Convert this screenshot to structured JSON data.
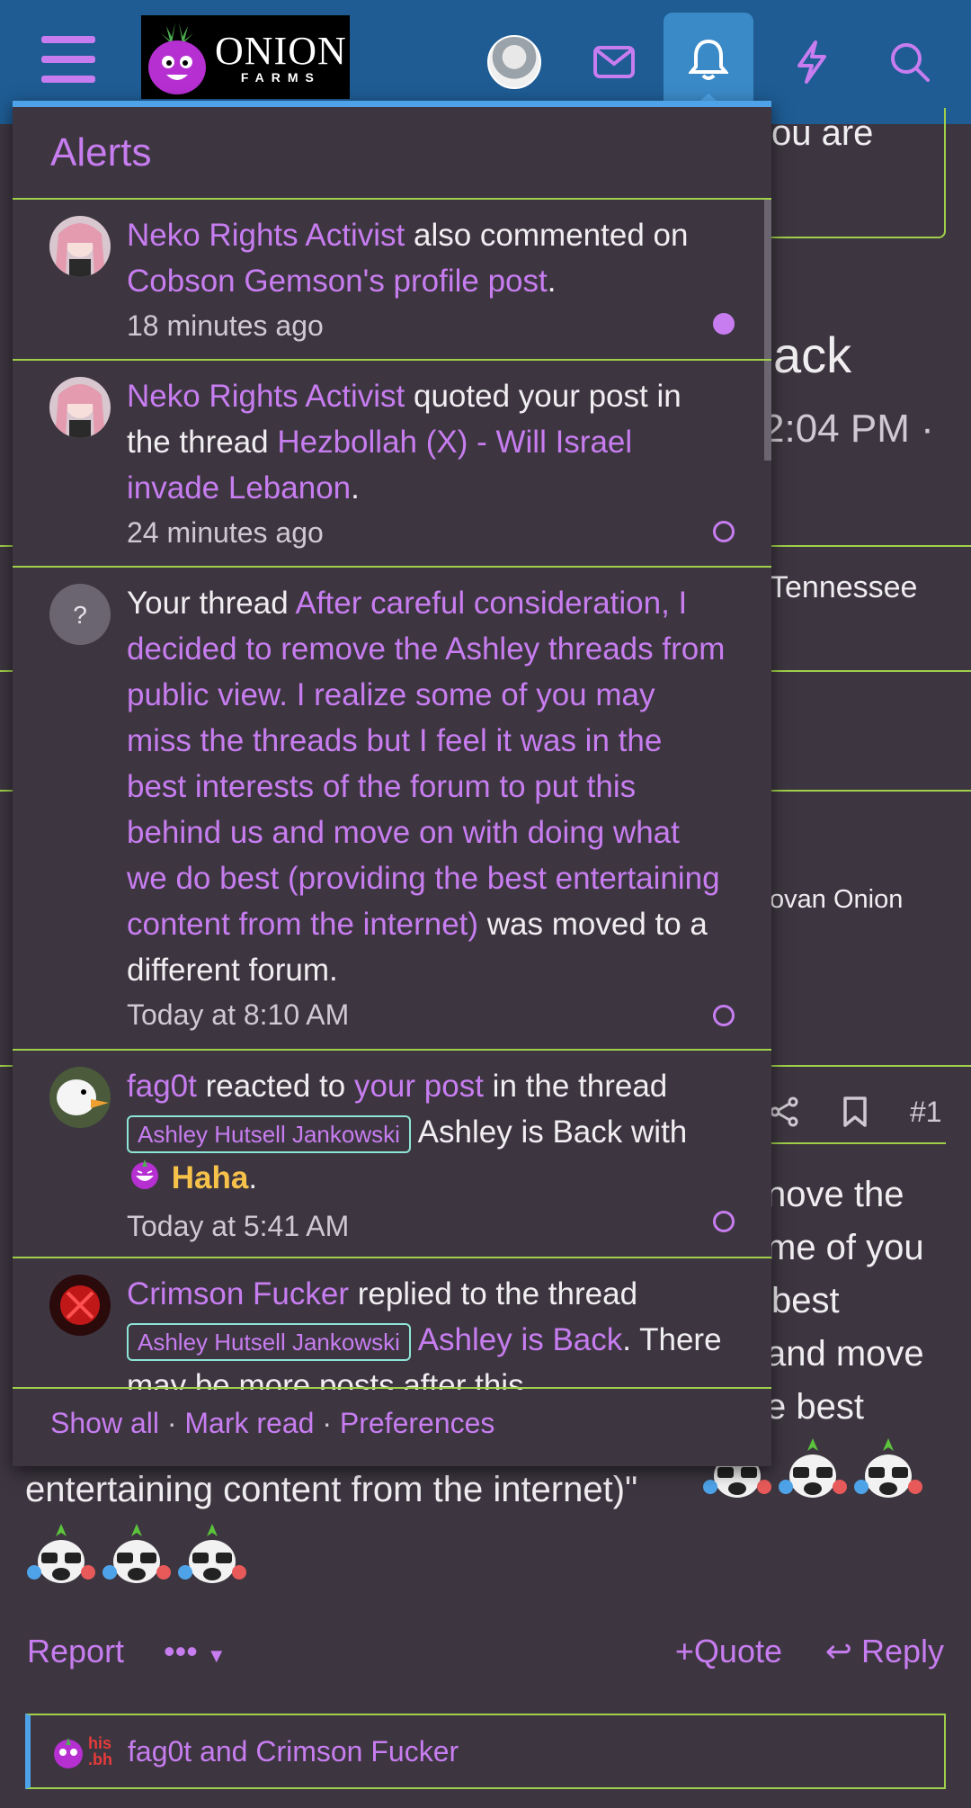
{
  "header": {
    "logo_big": "ONION",
    "logo_small": "FARMS"
  },
  "alerts": {
    "title": "Alerts",
    "items": [
      {
        "user": "Neko Rights Activist",
        "action": " also commented on ",
        "target": "Cobson Gemson's profile post",
        "tail": ".",
        "time": "18 minutes ago",
        "unread": true
      },
      {
        "user": "Neko Rights Activist",
        "action": " quoted your post in the thread ",
        "target": "Hezbollah (X) - Will Israel invade Lebanon",
        "tail": ".",
        "time": "24 minutes ago",
        "unread": false
      },
      {
        "avatar_letter": "?",
        "prefix": "Your thread ",
        "target": "After careful consideration, I decided to remove the Ashley threads from public view. I realize some of you may miss the threads but I feel it was in the best interests of the forum to put this behind us and move on with doing what we do best (providing the best entertaining content from the internet)",
        "tail": " was moved to a different forum.",
        "time": "Today at 8:10 AM",
        "unread": false
      },
      {
        "user": "fag0t",
        "action": " reacted to ",
        "target": "your post",
        "mid": " in the thread ",
        "prefix_tag": "Ashley Hutsell Jankowski",
        "thread": " Ashley is Back",
        "with": "with ",
        "reaction": "Haha",
        "tail": ".",
        "time": "Today at 5:41 AM",
        "unread": false
      },
      {
        "user": "Crimson Fucker",
        "action": " replied to the thread ",
        "prefix_tag": "Ashley Hutsell Jankowski",
        "thread": "Ashley is Back",
        "tail": ".",
        "extra": "There may be more posts after this."
      }
    ],
    "footer": {
      "show_all": "Show all",
      "sep": " · ",
      "mark_read": "Mark read",
      "preferences": "Preferences"
    }
  },
  "background": {
    "title_fragment": "ack",
    "time_fragment": "2:04 PM ·",
    "location_fragment": "Tennessee",
    "user_fragment": "ovan Onion",
    "post_number": "#1",
    "post_lines": [
      "nove the",
      "me of you",
      "best",
      "and move",
      "e best"
    ],
    "post_last": "entertaining content from the internet)\"",
    "top_fragment": "ou are"
  },
  "post_actions": {
    "report": "Report",
    "more": "•••",
    "quote": "Quote",
    "reply": "Reply"
  },
  "reactions": {
    "label": "his .bh",
    "users": "fag0t and Crimson Fucker"
  },
  "colors": {
    "header_bg": "#1e5c93",
    "accent_purple": "#c77df0",
    "accent_green": "#a0d04a",
    "accent_blue": "#4ea3e8",
    "page_bg": "#3d3640"
  }
}
